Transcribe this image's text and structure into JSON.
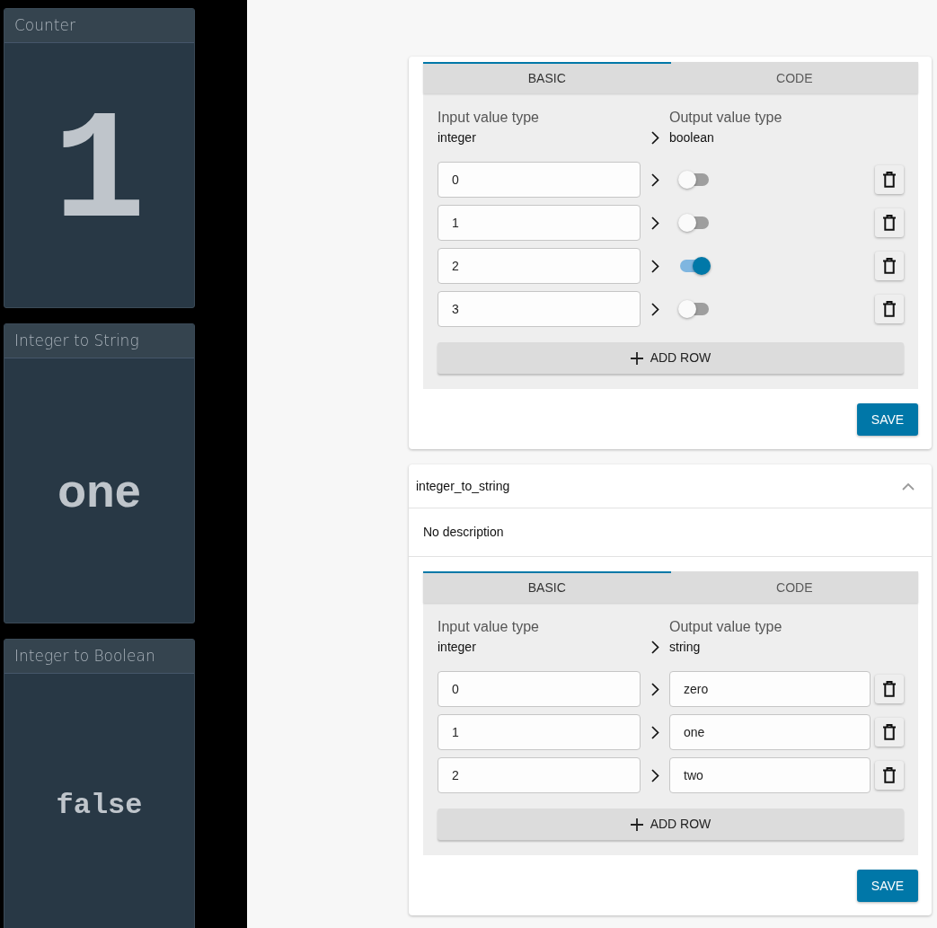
{
  "widgets": [
    {
      "kind": "number",
      "title": "Counter",
      "value": "1"
    },
    {
      "kind": "string",
      "title": "Integer to String",
      "value": "one"
    },
    {
      "kind": "boolean",
      "title": "Integer to Boolean",
      "value": "false"
    }
  ],
  "converters": [
    {
      "tabs": [
        {
          "label": "BASIC",
          "selected": true
        },
        {
          "label": "CODE",
          "selected": false
        }
      ],
      "input_label": "Input value type",
      "input_type": "integer",
      "output_label": "Output value type",
      "output_type": "boolean",
      "rows": [
        {
          "kind": "toggle",
          "input": "0",
          "on": false
        },
        {
          "kind": "toggle",
          "input": "1",
          "on": false
        },
        {
          "kind": "toggle",
          "input": "2",
          "on": true
        },
        {
          "kind": "toggle",
          "input": "3",
          "on": false
        }
      ],
      "add_row_button": "ADD ROW",
      "save_button": "SAVE"
    },
    {
      "title": "integer_to_string",
      "expanded": true,
      "description": "No description",
      "tabs": [
        {
          "label": "BASIC",
          "selected": true
        },
        {
          "label": "CODE",
          "selected": false
        }
      ],
      "input_label": "Input value type",
      "input_type": "integer",
      "output_label": "Output value type",
      "output_type": "string",
      "rows": [
        {
          "kind": "text",
          "input": "0",
          "output": "zero"
        },
        {
          "kind": "text",
          "input": "1",
          "output": "one"
        },
        {
          "kind": "text",
          "input": "2",
          "output": "two"
        }
      ],
      "add_row_button": "ADD ROW",
      "save_button": "SAVE"
    }
  ]
}
